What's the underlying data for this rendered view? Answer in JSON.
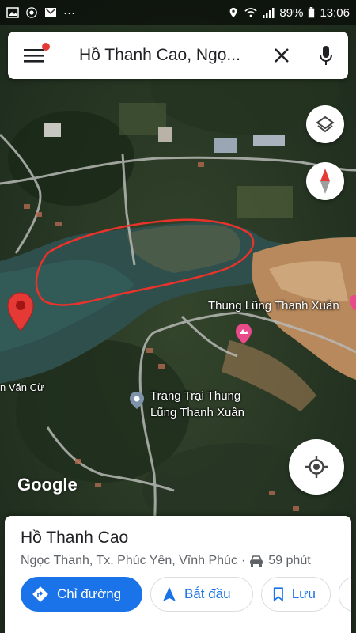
{
  "status_bar": {
    "battery": "89%",
    "time": "13:06",
    "more_indicator": "···"
  },
  "search": {
    "query": "Hồ Thanh Cao, Ngọ..."
  },
  "map": {
    "labels": {
      "valley": "Thung Lũng Thanh Xuân",
      "farm": "Trang Trại Thung Lũng Thanh Xuân",
      "road": "n Văn Cừ"
    },
    "logo": "Google"
  },
  "place": {
    "name": "Hồ Thanh Cao",
    "address": "Ngọc Thanh, Tx. Phúc Yên, Vĩnh Phúc",
    "separator": "·",
    "drive_time": "59 phút",
    "actions": {
      "directions": "Chỉ đường",
      "start": "Bắt đầu",
      "save": "Lưu"
    }
  },
  "colors": {
    "accent": "#1a73e8",
    "marker": "#e53935",
    "annotation": "#e8332c"
  }
}
